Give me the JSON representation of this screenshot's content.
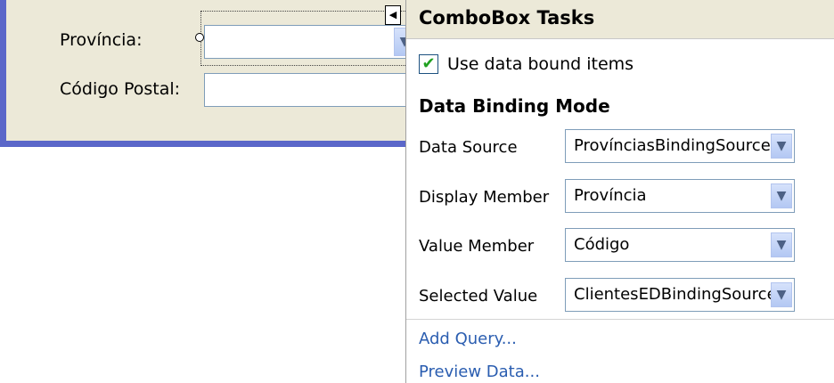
{
  "form": {
    "province_label": "Província:",
    "postal_code_label": "Código Postal:"
  },
  "smart_tag": {
    "title": "ComboBox Tasks",
    "use_data_bound_items": {
      "label": "Use data bound items",
      "checked": true
    },
    "section_header": "Data Binding Mode",
    "properties": [
      {
        "label": "Data Source",
        "value": "ProvínciasBindingSource"
      },
      {
        "label": "Display Member",
        "value": "Província"
      },
      {
        "label": "Value Member",
        "value": "Código"
      },
      {
        "label": "Selected Value",
        "value": "ClientesEDBindingSource -"
      }
    ],
    "links": {
      "add_query": "Add Query...",
      "preview_data": "Preview Data..."
    }
  },
  "colors": {
    "form_background": "#ece9d8",
    "form_border": "#5b67c9",
    "link": "#2a5db0",
    "checkmark": "#21a121"
  },
  "icons": {
    "dropdown": "chevron-down-icon",
    "smart_tag": "smart-tag-arrow-icon",
    "check": "checkmark-icon"
  }
}
